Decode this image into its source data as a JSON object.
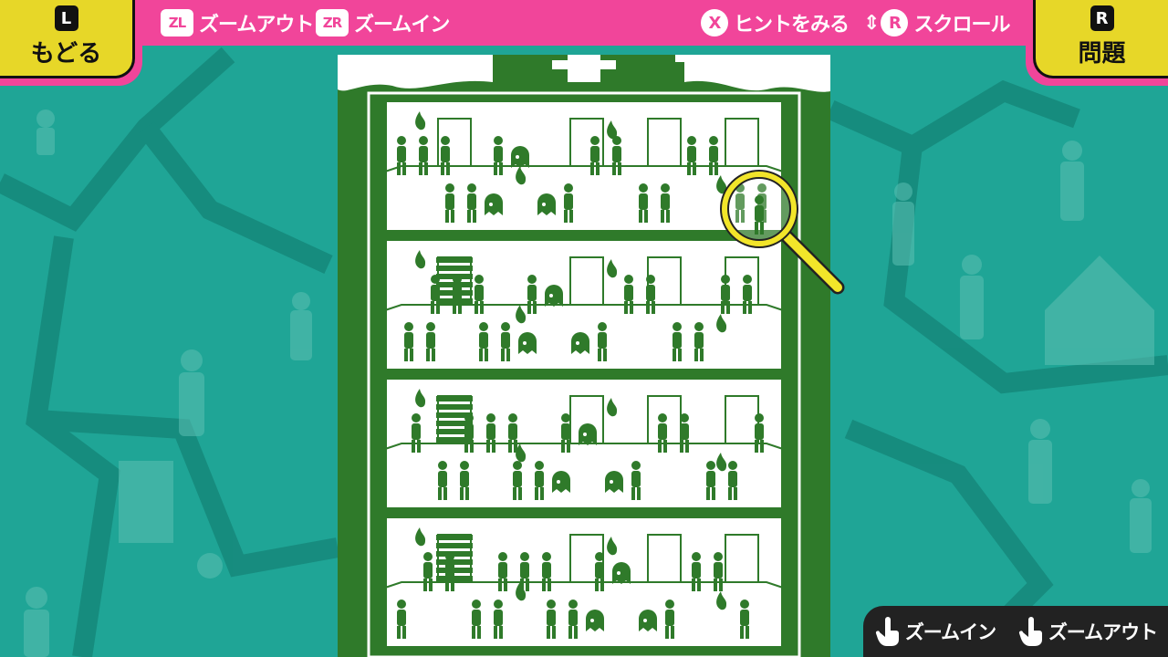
{
  "top_bar": {
    "zoom_out": {
      "key": "ZL",
      "label": "ズームアウト"
    },
    "zoom_in": {
      "key": "ZR",
      "label": "ズームイン"
    },
    "hint": {
      "key": "X",
      "label": "ヒントをみる"
    },
    "scroll": {
      "key": "R",
      "label": "スクロール"
    }
  },
  "back": {
    "key": "L",
    "label": "もどる"
  },
  "question": {
    "key": "R",
    "label": "問題"
  },
  "touch_controls": {
    "zoom_in": "ズームイン",
    "zoom_out": "ズームアウト"
  },
  "colors": {
    "pink": "#f1459a",
    "yellow": "#e7d728",
    "teal": "#1fa596",
    "board_green": "#2f7a2a"
  },
  "icons": [
    "hand-tap-icon",
    "hand-pinch-icon",
    "magnifier-icon",
    "stick-figure-icon",
    "fire-icon",
    "ghost-icon"
  ]
}
